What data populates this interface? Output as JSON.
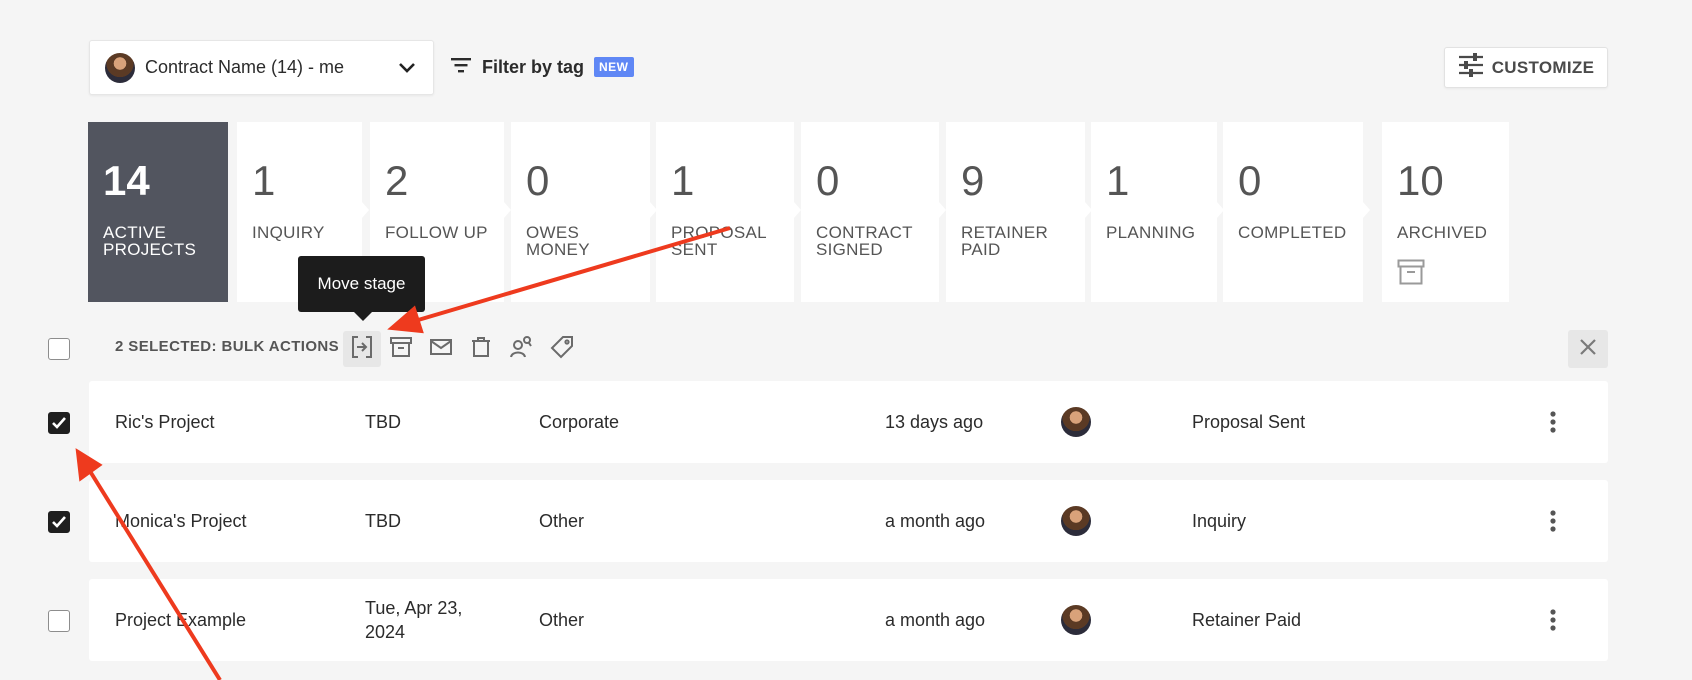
{
  "filter": {
    "label": "Contract Name (14) - me"
  },
  "tag_filter": {
    "label": "Filter by tag",
    "badge": "NEW"
  },
  "customize": {
    "label": "CUSTOMIZE"
  },
  "pipeline": [
    {
      "count": "14",
      "name": "ACTIVE\nPROJECTS"
    },
    {
      "count": "1",
      "name": "INQUIRY"
    },
    {
      "count": "2",
      "name": "FOLLOW UP"
    },
    {
      "count": "0",
      "name": "OWES\nMONEY"
    },
    {
      "count": "1",
      "name": "PROPOSAL\nSENT"
    },
    {
      "count": "0",
      "name": "CONTRACT\nSIGNED"
    },
    {
      "count": "9",
      "name": "RETAINER\nPAID"
    },
    {
      "count": "1",
      "name": "PLANNING"
    },
    {
      "count": "0",
      "name": "COMPLETED"
    },
    {
      "count": "10",
      "name": "ARCHIVED"
    }
  ],
  "bulk": {
    "label": "2 SELECTED: BULK ACTIONS",
    "tooltip": "Move stage",
    "actions": [
      "move-stage-icon",
      "archive-icon",
      "email-icon",
      "delete-icon",
      "assign-user-icon",
      "tag-icon"
    ]
  },
  "rows": [
    {
      "checked": true,
      "name": "Ric's Project",
      "date": "TBD",
      "type": "Corporate",
      "updated": "13 days ago",
      "stage": "Proposal Sent"
    },
    {
      "checked": true,
      "name": "Monica's Project",
      "date": "TBD",
      "type": "Other",
      "updated": "a month ago",
      "stage": "Inquiry"
    },
    {
      "checked": false,
      "name": "Project Example",
      "date": "Tue, Apr 23,\n2024",
      "type": "Other",
      "updated": "a month ago",
      "stage": "Retainer Paid"
    }
  ],
  "colors": {
    "active_stage": "#52555f",
    "badge": "#5f87f5",
    "annotation_arrow": "#ee3a1e"
  }
}
